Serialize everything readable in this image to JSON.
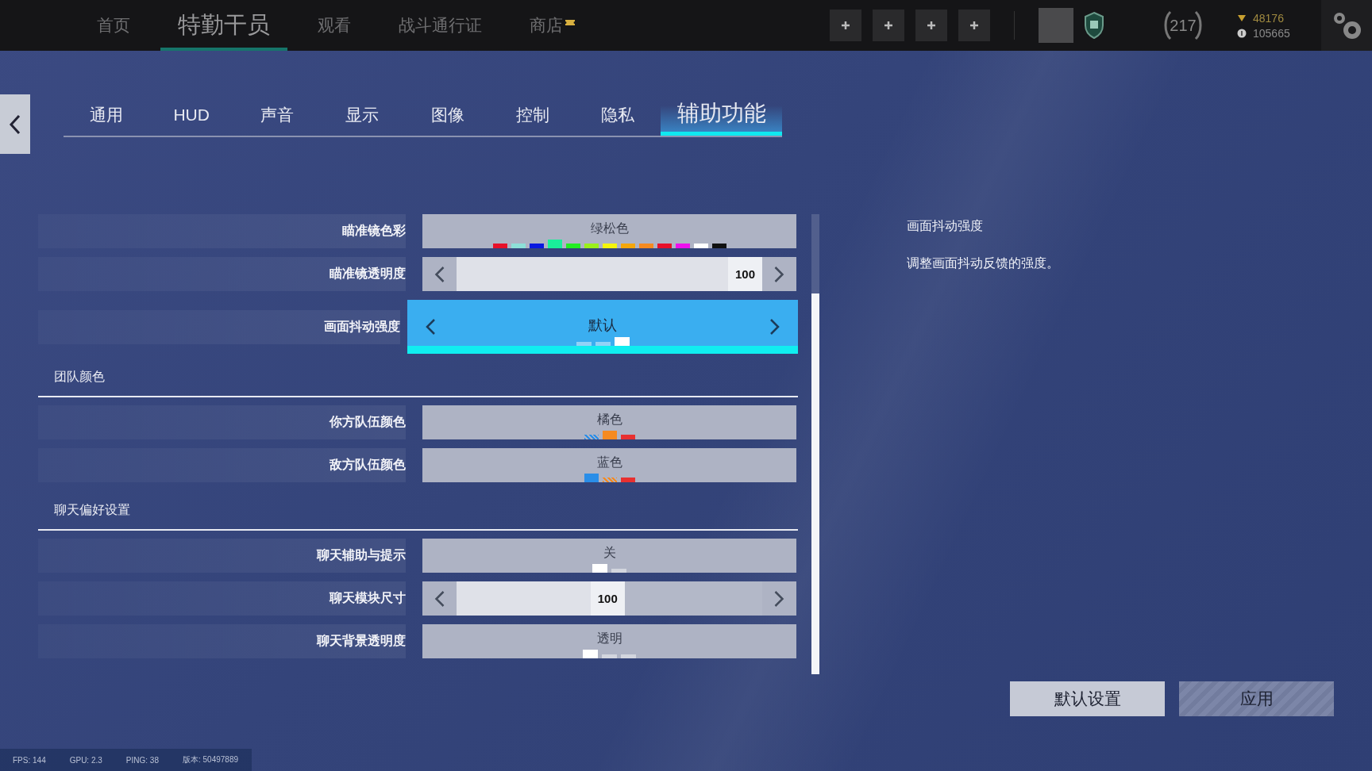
{
  "top_nav": {
    "items": [
      {
        "label": "首页",
        "selected": false
      },
      {
        "label": "特勤干员",
        "selected": true
      },
      {
        "label": "观看",
        "selected": false
      },
      {
        "label": "战斗通行证",
        "selected": false
      },
      {
        "label": "商店",
        "selected": false,
        "new": true
      }
    ]
  },
  "level": "217",
  "currencies": [
    {
      "kind": "gold",
      "amount": "48176"
    },
    {
      "kind": "coin",
      "amount": "105665"
    }
  ],
  "tabs": [
    {
      "label": "通用",
      "selected": false
    },
    {
      "label": "HUD",
      "selected": false
    },
    {
      "label": "声音",
      "selected": false
    },
    {
      "label": "显示",
      "selected": false
    },
    {
      "label": "图像",
      "selected": false
    },
    {
      "label": "控制",
      "selected": false
    },
    {
      "label": "隐私",
      "selected": false
    },
    {
      "label": "辅助功能",
      "selected": true
    }
  ],
  "settings": [
    {
      "kind": "swatch",
      "label": "瞄准镜色彩",
      "value": "绿松色",
      "focused": false,
      "swatches": [
        {
          "color": "#e8102a",
          "selected": false
        },
        {
          "color": "#8de0d8",
          "selected": false
        },
        {
          "color": "#0a18e0",
          "selected": false
        },
        {
          "color": "#1aef9a",
          "selected": true
        },
        {
          "color": "#22ee22",
          "selected": false
        },
        {
          "color": "#9af01a",
          "selected": false
        },
        {
          "color": "#f5f50a",
          "selected": false
        },
        {
          "color": "#f5a60a",
          "selected": false
        },
        {
          "color": "#f58a20",
          "selected": false
        },
        {
          "color": "#e8102a",
          "selected": false
        },
        {
          "color": "#ee10ee",
          "selected": false
        },
        {
          "color": "#ffffff",
          "selected": false
        },
        {
          "color": "#111111",
          "selected": false
        }
      ]
    },
    {
      "kind": "slider",
      "label": "瞄准镜透明度",
      "value": "100",
      "level": 1,
      "focused": false
    },
    {
      "kind": "choice",
      "label": "画面抖动强度",
      "value": "默认",
      "focused": true,
      "steps": [
        {
          "selected": false
        },
        {
          "selected": false
        },
        {
          "selected": true
        }
      ]
    },
    {
      "kind": "section",
      "label": "团队颜色"
    },
    {
      "kind": "swatch",
      "label": "你方队伍颜色",
      "value": "橘色",
      "focused": false,
      "swatches": [
        {
          "color": "#2a8ee8",
          "selected": false,
          "striped": true
        },
        {
          "color": "#f58a20",
          "selected": true,
          "striped": false
        },
        {
          "color": "#e83030",
          "selected": false,
          "striped": false
        }
      ]
    },
    {
      "kind": "swatch",
      "label": "敌方队伍颜色",
      "value": "蓝色",
      "focused": false,
      "swatches": [
        {
          "color": "#2a8ee8",
          "selected": true,
          "striped": false
        },
        {
          "color": "#f58a20",
          "selected": false,
          "striped": true
        },
        {
          "color": "#e83030",
          "selected": false,
          "striped": false
        }
      ]
    },
    {
      "kind": "section",
      "label": "聊天偏好设置"
    },
    {
      "kind": "choice",
      "label": "聊天辅助与提示",
      "value": "关",
      "focused": false,
      "steps": [
        {
          "selected": true
        },
        {
          "selected": false
        }
      ]
    },
    {
      "kind": "slider",
      "label": "聊天模块尺寸",
      "value": "100",
      "level": 0.55,
      "focused": false
    },
    {
      "kind": "choice",
      "label": "聊天背景透明度",
      "value": "透明",
      "focused": false,
      "steps": [
        {
          "selected": true
        },
        {
          "selected": false
        },
        {
          "selected": false
        }
      ]
    }
  ],
  "description": {
    "title": "画面抖动强度",
    "text": "调整画面抖动反馈的强度。"
  },
  "buttons": [
    {
      "label": "默认设置",
      "disabled": false
    },
    {
      "label": "应用",
      "disabled": true
    }
  ],
  "stats": [
    "FPS: 144",
    "GPU: 2.3",
    "PING: 38",
    "版本: 50497889"
  ]
}
